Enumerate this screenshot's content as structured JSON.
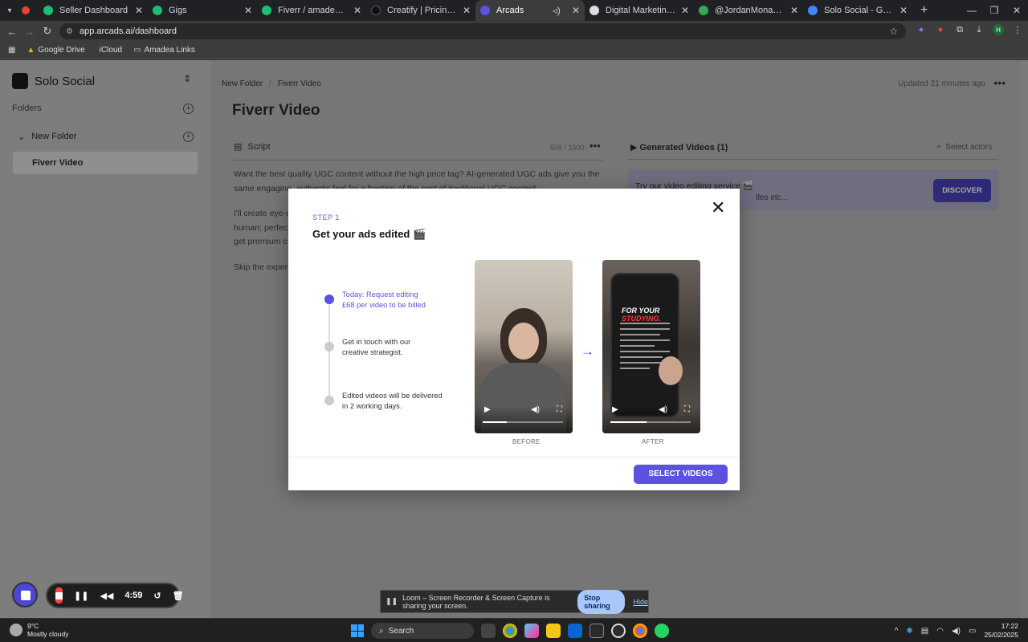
{
  "browser": {
    "tabs": [
      {
        "label": "",
        "favicon_color": "#e94235",
        "active": false
      },
      {
        "label": "Seller Dashboard",
        "favicon_color": "#1dbf73",
        "active": false
      },
      {
        "label": "Gigs",
        "favicon_color": "#1dbf73",
        "active": false
      },
      {
        "label": "Fiverr / amadeaventures / E",
        "favicon_color": "#1dbf73",
        "active": false
      },
      {
        "label": "Creatify | Pricing Plans for b",
        "favicon_color": "#111111",
        "active": false
      },
      {
        "label": "Arcads",
        "favicon_color": "#5b52e0",
        "active": true
      },
      {
        "label": "Digital Marketing Assistanc",
        "favicon_color": "#dddddd",
        "active": false
      },
      {
        "label": "@JordanMonaghanTV | Twi",
        "favicon_color": "#34a853",
        "active": false
      },
      {
        "label": "Solo Social - Google Drive",
        "favicon_color": "#4285f4",
        "active": false
      }
    ],
    "url": "app.arcads.ai/dashboard",
    "bookmarks": [
      "Google Drive",
      "iCloud",
      "Amadea Links"
    ]
  },
  "sidebar": {
    "brand": "Solo Social",
    "folders_heading": "Folders",
    "folder": "New Folder",
    "video": "Fiverr Video"
  },
  "main": {
    "breadcrumb": [
      "New Folder",
      "Fiverr Video"
    ],
    "updated": "Updated 21 minutes ago",
    "title": "Fiverr Video",
    "script_heading": "Script",
    "script_count": "508 / 1500",
    "script_paragraphs": [
      "Want the best quality UGC content without the high price tag? AI-generated UGC ads give you the same engaging, authentic feel for a fraction of the cost of traditional UGC content.",
      "I'll create eye-c",
      "human; perfect",
      "get premium c",
      "Skip the expens"
    ],
    "generated_heading": "Generated Videos (1)",
    "select_actors": "Select actors",
    "promo_title": "Try our video editing service 🎬",
    "promo_sub": "tles etc...",
    "discover": "DISCOVER"
  },
  "modal": {
    "step": "STEP 1",
    "title": "Get your ads edited 🎬",
    "steps": [
      {
        "line1": "Today: Request editing",
        "line2": "£68 per video to be billed",
        "active": true
      },
      {
        "line1": "Get in touch with our",
        "line2": "creative strategist.",
        "active": false
      },
      {
        "line1": "Edited videos will be delivered",
        "line2": "in 2 working days.",
        "active": false
      }
    ],
    "before_label": "BEFORE",
    "after_label": "AFTER",
    "after_overlay_a": "FOR YOUR ",
    "after_overlay_b": "STUDYING.",
    "button": "SELECT VIDEOS"
  },
  "loom": {
    "timer": "4:59",
    "share_text": "Loom – Screen Recorder & Screen Capture is sharing your screen.",
    "stop_sharing": "Stop sharing",
    "hide": "Hide"
  },
  "taskbar": {
    "temp": "9°C",
    "weather": "Mostly cloudy",
    "search": "Search",
    "time": "17:22",
    "date": "25/02/2025"
  }
}
